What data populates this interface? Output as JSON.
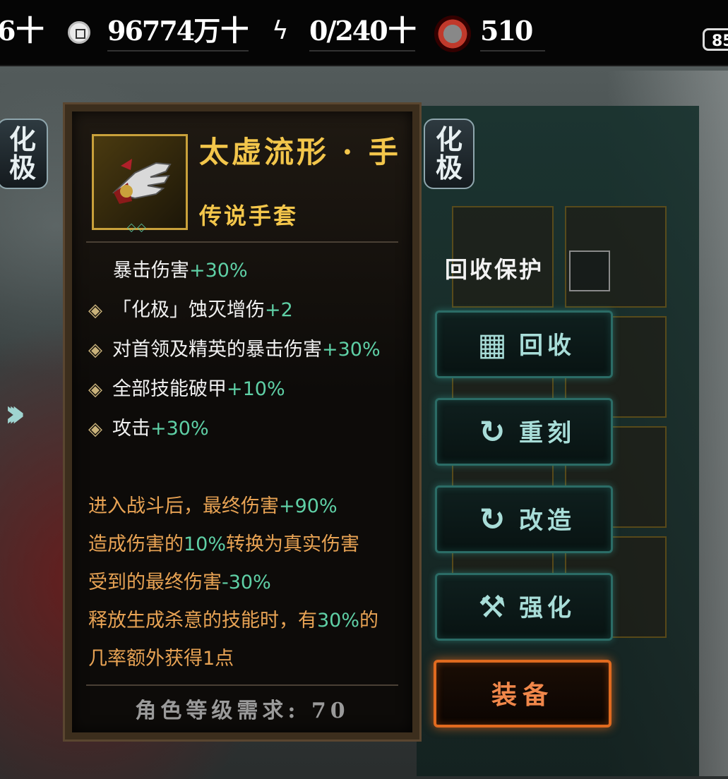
{
  "topbar": {
    "resource_partial": "6",
    "coins": "96774万",
    "energy": "0/240",
    "tokens": "510",
    "plus": "十",
    "level_partial": "85"
  },
  "badges": {
    "huaji": "化极"
  },
  "item": {
    "name": "太虚流形 · 手",
    "type": "传说手套",
    "gems": "◇◇",
    "stats": [
      {
        "label": "暴击伤害",
        "value": "+30%"
      },
      {
        "label": "「化极」蚀灭增伤",
        "value": "+2"
      },
      {
        "label": "对首领及精英的暴击伤害",
        "value": "+30%"
      },
      {
        "label": "全部技能破甲",
        "value": "+10%"
      },
      {
        "label": "攻击",
        "value": "+30%"
      }
    ],
    "effects": [
      {
        "pre": "进入战斗后，最终伤害",
        "val": "+90%",
        "post": ""
      },
      {
        "pre": "造成伤害的",
        "val": "10%",
        "post": "转换为真实伤害"
      },
      {
        "pre": "受到的最终伤害",
        "val": "-30%",
        "post": ""
      },
      {
        "pre": "释放生成杀意的技能时，有",
        "val": "30%",
        "post": "的"
      },
      {
        "pre": "几率额外获得1点",
        "val": "",
        "post": ""
      }
    ],
    "requirement": "角色等级需求: 70"
  },
  "actions": {
    "recycle_protect": "回收保护",
    "recycle": "回收",
    "reforge": "重刻",
    "modify": "改造",
    "enhance": "强化",
    "equip": "装备"
  },
  "colors": {
    "gold": "#f3c64b",
    "stat_value": "#5fd0a6",
    "effect_text": "#e8a354",
    "action_text": "#a8ddd8",
    "equip_border": "#e06a1f"
  }
}
